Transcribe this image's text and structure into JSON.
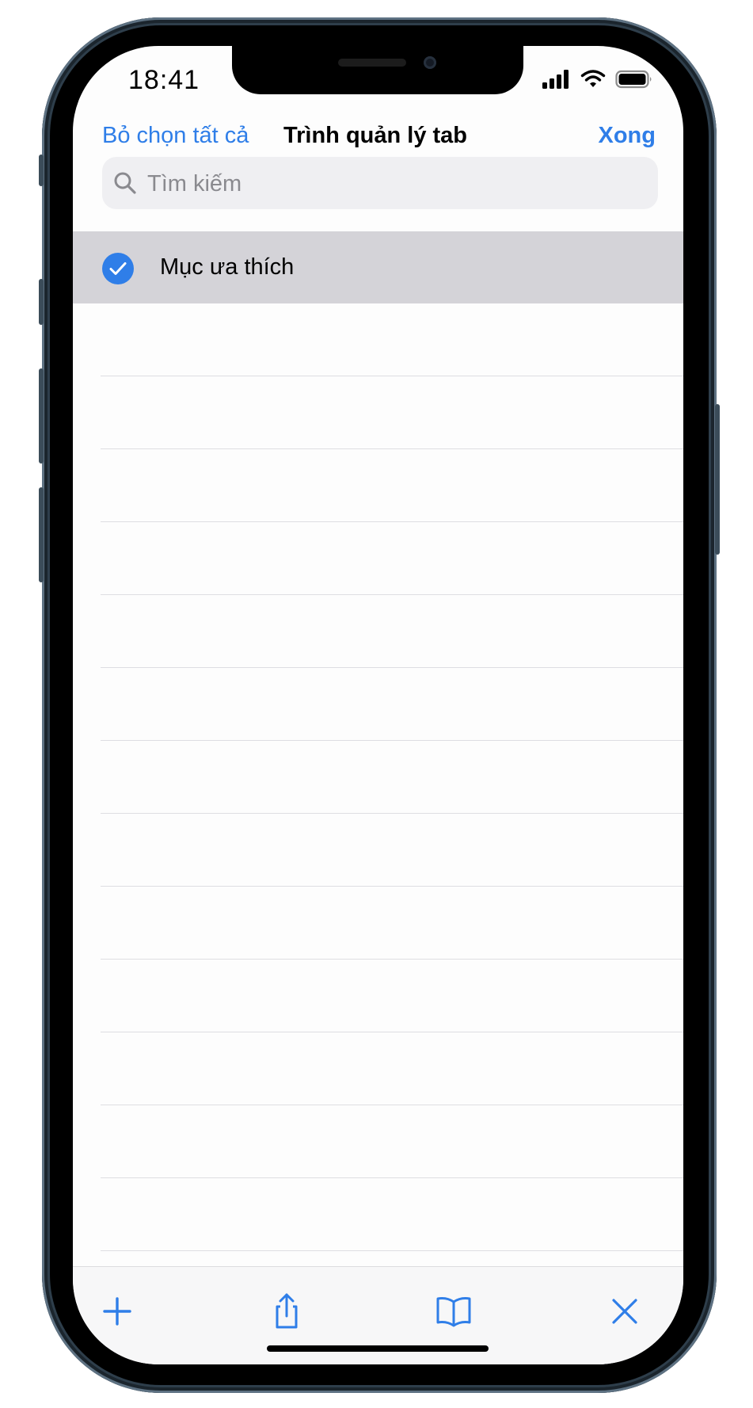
{
  "status_bar": {
    "time": "18:41"
  },
  "nav": {
    "left_label": "Bỏ chọn tất cả",
    "title": "Trình quản lý tab",
    "right_label": "Xong"
  },
  "search": {
    "placeholder": "Tìm kiếm"
  },
  "list": {
    "items": [
      {
        "label": "Mục ưa thích",
        "selected": true
      }
    ]
  },
  "toolbar": {
    "icons": [
      "plus-icon",
      "share-icon",
      "book-icon",
      "close-icon"
    ]
  },
  "colors": {
    "accent": "#2f7ee8",
    "selected_row": "#d4d3d8"
  }
}
